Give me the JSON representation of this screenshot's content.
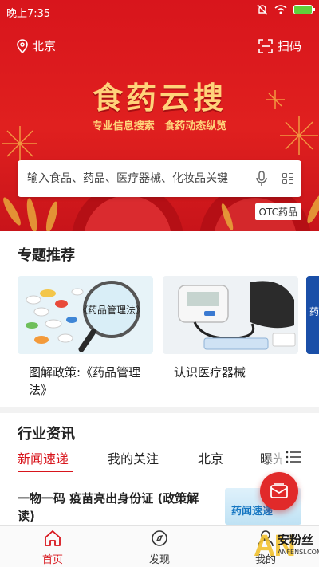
{
  "status_bar": {
    "time": "晚上7:35"
  },
  "header": {
    "location": "北京",
    "scan_label": "扫码",
    "brand_title": "食药云搜",
    "brand_subtitle": "专业信息搜索  食药动态纵览"
  },
  "search": {
    "placeholder": "输入食品、药品、医疗器械、化妆品关键"
  },
  "otc_tag": "OTC药品",
  "topics": {
    "title": "专题推荐",
    "cards": [
      {
        "caption": "图解政策:《药品管理法》",
        "thumb_text": "《药品管理法》"
      },
      {
        "caption": "认识医疗器械"
      },
      {
        "caption": "药"
      }
    ]
  },
  "news": {
    "title": "行业资讯",
    "tabs": [
      "新闻速递",
      "我的关注",
      "北京",
      "曝光"
    ],
    "active_tab": "新闻速递",
    "article": {
      "title": "一物一码 疫苗亮出身份证 (政策解读)",
      "thumb_text": "药闻速递"
    }
  },
  "bottom_nav": {
    "items": [
      {
        "label": "首页",
        "icon": "home-icon",
        "active": true
      },
      {
        "label": "发现",
        "icon": "compass-icon",
        "active": false
      },
      {
        "label": "我的",
        "icon": "person-icon",
        "active": false
      }
    ]
  },
  "watermark": {
    "mark": "AN",
    "name": "安粉丝",
    "url": "ANFENSI.COM"
  },
  "colors": {
    "brand_red": "#d8151c",
    "gold": "#ffd37a",
    "active_tab": "#d8151c"
  }
}
